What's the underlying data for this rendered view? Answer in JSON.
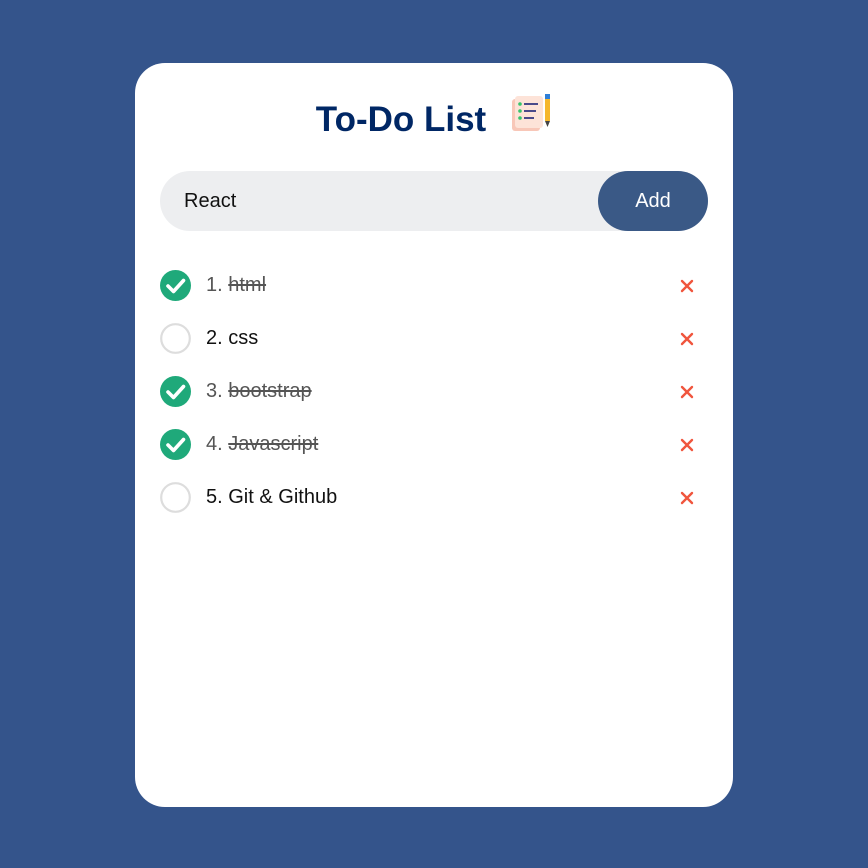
{
  "app": {
    "title": "To-Do List",
    "title_icon": "checklist-notepad-icon"
  },
  "input": {
    "value": "React",
    "add_label": "Add"
  },
  "todos": [
    {
      "number": "1.",
      "text": "html",
      "done": true
    },
    {
      "number": "2.",
      "text": "css",
      "done": false
    },
    {
      "number": "3.",
      "text": "bootstrap",
      "done": true
    },
    {
      "number": "4.",
      "text": "Javascript",
      "done": true
    },
    {
      "number": "5.",
      "text": "Git & Github",
      "done": false
    }
  ],
  "colors": {
    "background": "#34548b",
    "title": "#002765",
    "check_done": "#1fa97a",
    "check_empty_border": "#dddddd",
    "delete": "#f0553d",
    "add_button": "#3a5986"
  },
  "icons": {
    "done": "check-circle-icon",
    "undone": "empty-circle-icon",
    "delete": "close-icon"
  }
}
